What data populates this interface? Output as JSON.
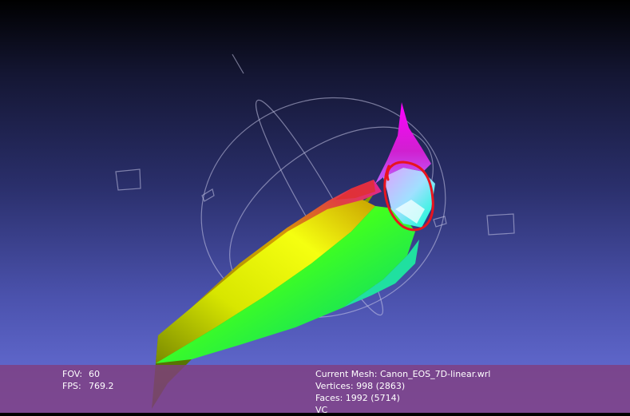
{
  "viewer": {
    "background_top": "#000000",
    "background_bottom": "#6b73dd",
    "annotation_color": "#e8141e"
  },
  "info": {
    "fov_label": "FOV:",
    "fov_value": "60",
    "fps_label": "FPS:",
    "fps_value": "769.2",
    "current_mesh": "Current Mesh: Canon_EOS_7D-linear.wrl",
    "vertices": "Vertices: 998 (2863)",
    "faces": "Faces: 1992 (5714)",
    "extra": "VC"
  },
  "icons": {
    "trackball": "trackball-gizmo-icon"
  }
}
